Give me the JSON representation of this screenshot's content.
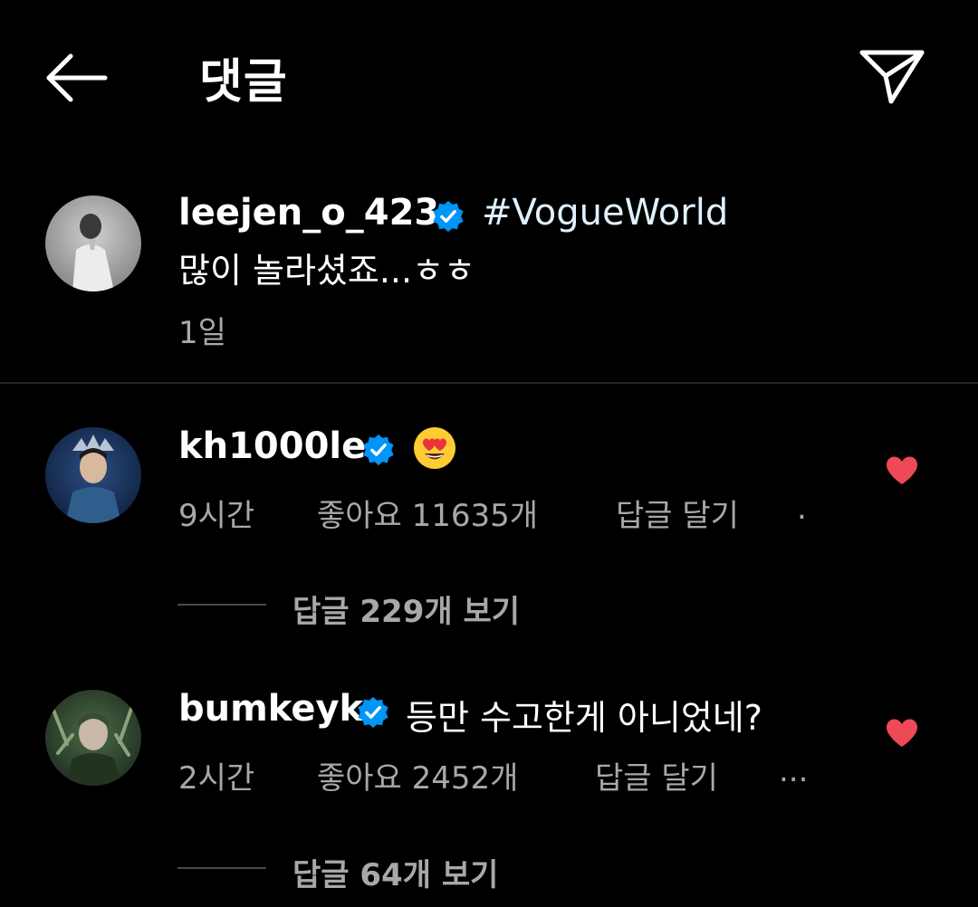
{
  "header": {
    "title": "댓글"
  },
  "caption": {
    "username": "leejen_o_423",
    "hashtag": "#VogueWorld",
    "text": "많이 놀라셨죠...ㅎㅎ",
    "time": "1일"
  },
  "comments": [
    {
      "username": "kh1000le",
      "text": "😍",
      "time": "9시간",
      "likes": "좋아요 11635개",
      "reply_label": "답글 달기",
      "more": ".",
      "view_replies": "답글 229개 보기",
      "liked": true
    },
    {
      "username": "bumkeyk",
      "text": "등만 수고한게 아니었네?",
      "time": "2시간",
      "likes": "좋아요 2452개",
      "reply_label": "답글 달기",
      "more": "...",
      "view_replies": "답글 64개 보기",
      "liked": true
    }
  ],
  "colors": {
    "background": "#000000",
    "verified": "#0095f6",
    "heart": "#ed4956",
    "secondary_text": "#a8a8a8",
    "hashtag": "#e0f1ff"
  },
  "icons": {
    "back": "arrow-left-icon",
    "send": "paper-plane-icon",
    "verified": "verified-badge-icon",
    "like": "heart-filled-icon"
  }
}
